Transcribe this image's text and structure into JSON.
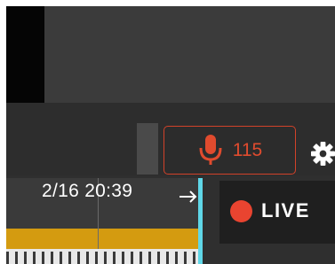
{
  "talkback": {
    "icon": "microphone-icon",
    "count": "115",
    "accent": "#e04b2e"
  },
  "settings": {
    "icon": "gear-icon"
  },
  "timeline": {
    "timestamp": "2/16 20:39",
    "arrow_icon": "arrow-right-icon",
    "recording_color": "#d49b10",
    "playhead_color": "#5fd7e8"
  },
  "live": {
    "label": "LIVE",
    "dot_color": "#e94430"
  }
}
